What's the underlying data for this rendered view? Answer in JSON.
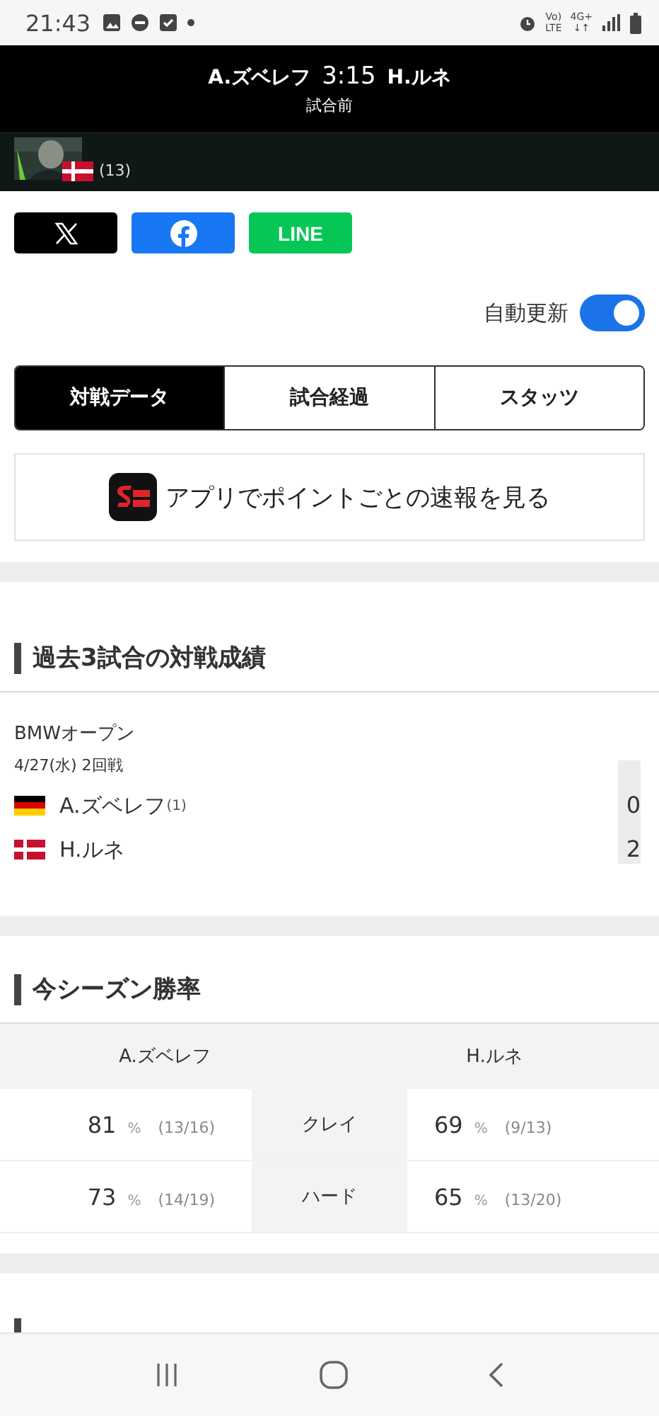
{
  "status_bar": {
    "time": "21:43",
    "volte": "Vo)",
    "volte_sub": "LTE",
    "network": "4G+",
    "network_sub": "↓↑"
  },
  "match_header": {
    "player_1": "A.ズベレフ",
    "time": "3:15",
    "player_2": "H.ルネ",
    "status": "試合前"
  },
  "player_strip": {
    "seed": "(13)",
    "kind": "denmark"
  },
  "share_buttons": [
    {
      "kind": "x"
    },
    {
      "kind": "facebook"
    },
    {
      "kind": "line",
      "label": "LINE"
    }
  ],
  "auto_update": {
    "label": "自動更新",
    "on": true
  },
  "tabs": [
    {
      "label": "対戦データ",
      "selected": true
    },
    {
      "label": "試合経過",
      "selected": false
    },
    {
      "label": "スタッツ",
      "selected": false
    }
  ],
  "app_banner": {
    "label": "アプリでポイントごとの速報を見る"
  },
  "head_to_head": {
    "title": "過去3試合の対戦成績",
    "matches": [
      {
        "tournament": "BMWオープン",
        "date": "4/27(水) 2回戦",
        "players": [
          {
            "name": "A.ズベレフ",
            "seed": "(1)",
            "kind": "germany",
            "score": "0"
          },
          {
            "name": "H.ルネ",
            "kind": "denmark",
            "score": "2"
          }
        ]
      }
    ]
  },
  "season_win_rate": {
    "title": "今シーズン勝率",
    "columns": [
      "A.ズベレフ",
      "H.ルネ"
    ],
    "rows": [
      {
        "surface": "クレイ",
        "left": {
          "pct": "81",
          "unit": "%",
          "record": "(13/16)"
        },
        "right": {
          "pct": "69",
          "unit": "%",
          "record": "(9/13)"
        }
      },
      {
        "surface": "ハード",
        "left": {
          "pct": "73",
          "unit": "%",
          "record": "(14/19)"
        },
        "right": {
          "pct": "65",
          "unit": "%",
          "record": "(13/20)"
        }
      }
    ]
  }
}
